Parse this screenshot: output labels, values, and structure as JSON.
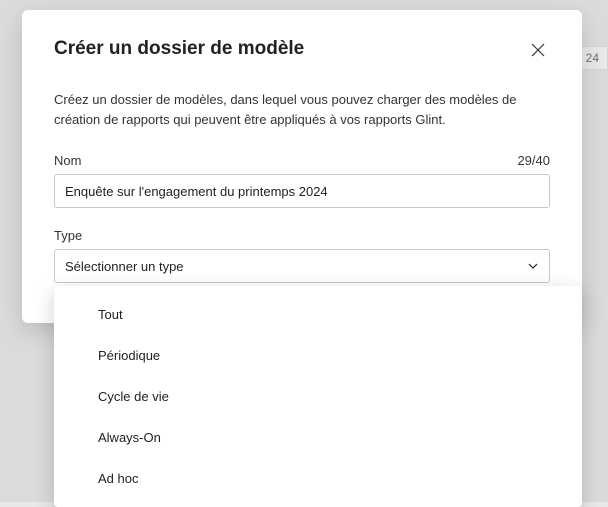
{
  "background": {
    "date_chip": "24"
  },
  "modal": {
    "title": "Créer un dossier de modèle",
    "description": "Créez un dossier de modèles, dans lequel vous pouvez charger des modèles de création de rapports qui peuvent être appliqués à vos rapports Glint.",
    "name_field": {
      "label": "Nom",
      "value": "Enquête sur l'engagement du printemps 2024",
      "char_count": "29/40"
    },
    "type_field": {
      "label": "Type",
      "placeholder": "Sélectionner un type",
      "options": [
        "Tout",
        "Périodique",
        "Cycle de vie",
        "Always-On",
        "Ad hoc"
      ]
    }
  }
}
